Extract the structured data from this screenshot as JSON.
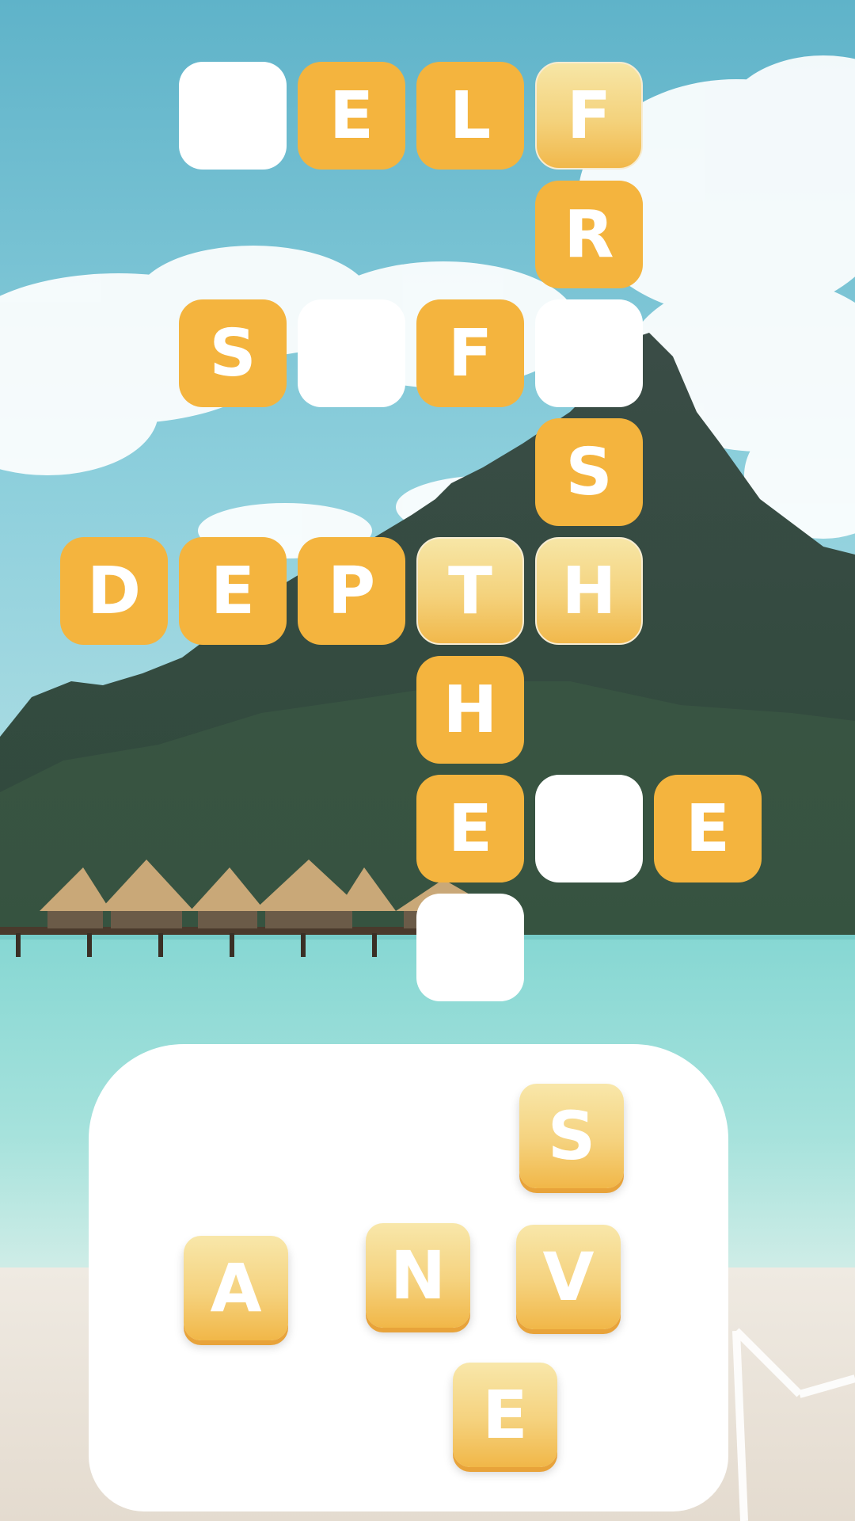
{
  "colors": {
    "tile_filled": "#f4b43e",
    "tile_highlight": "#f5d27e",
    "tile_empty": "#ffffff",
    "letter": "#ffffff",
    "sky": "#7cc4d4",
    "sea": "#8fdcd6"
  },
  "board": {
    "tiles": [
      {
        "id": "r1c1",
        "letter": "",
        "state": "empty"
      },
      {
        "id": "r1c2",
        "letter": "E",
        "state": "filled"
      },
      {
        "id": "r1c3",
        "letter": "L",
        "state": "filled"
      },
      {
        "id": "r1c4",
        "letter": "F",
        "state": "highlight"
      },
      {
        "id": "r2c4",
        "letter": "R",
        "state": "filled"
      },
      {
        "id": "r3c1",
        "letter": "S",
        "state": "filled"
      },
      {
        "id": "r3c2",
        "letter": "",
        "state": "empty"
      },
      {
        "id": "r3c3",
        "letter": "F",
        "state": "filled"
      },
      {
        "id": "r3c4",
        "letter": "",
        "state": "empty"
      },
      {
        "id": "r4c4",
        "letter": "S",
        "state": "filled"
      },
      {
        "id": "r5c0",
        "letter": "D",
        "state": "filled"
      },
      {
        "id": "r5c1",
        "letter": "E",
        "state": "filled"
      },
      {
        "id": "r5c2",
        "letter": "P",
        "state": "filled"
      },
      {
        "id": "r5c3",
        "letter": "T",
        "state": "highlight"
      },
      {
        "id": "r5c4",
        "letter": "H",
        "state": "highlight"
      },
      {
        "id": "r6c3",
        "letter": "H",
        "state": "filled"
      },
      {
        "id": "r7c3",
        "letter": "E",
        "state": "filled"
      },
      {
        "id": "r7c4",
        "letter": "",
        "state": "empty"
      },
      {
        "id": "r7c5",
        "letter": "E",
        "state": "filled"
      },
      {
        "id": "r8c3",
        "letter": "",
        "state": "empty"
      }
    ]
  },
  "wheel": {
    "letters": [
      {
        "id": "s",
        "letter": "S"
      },
      {
        "id": "a",
        "letter": "A"
      },
      {
        "id": "n",
        "letter": "N"
      },
      {
        "id": "v",
        "letter": "V"
      },
      {
        "id": "e",
        "letter": "E"
      }
    ]
  }
}
